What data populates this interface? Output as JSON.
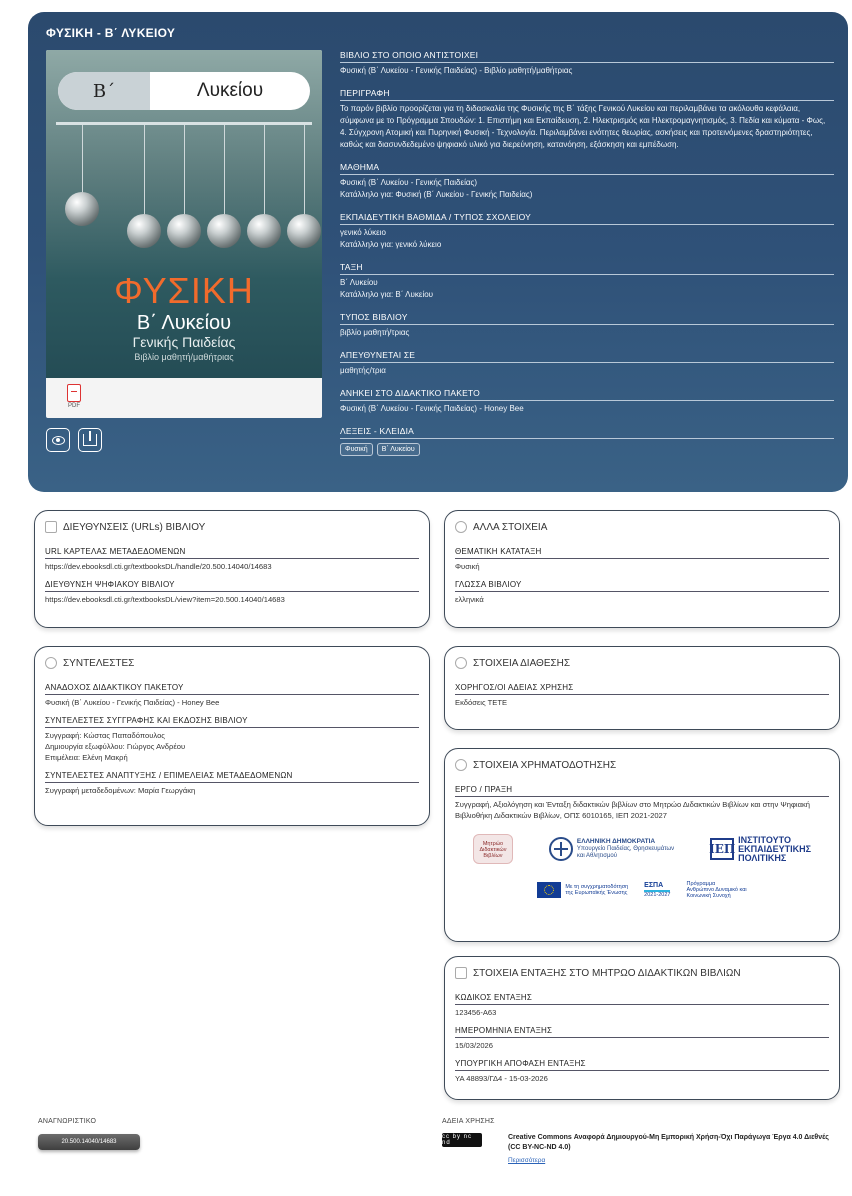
{
  "hero": {
    "title": "ΦΥΣΙΚΗ - Β΄ ΛΥΚΕΙΟΥ",
    "cover": {
      "pill_left": "Β΄",
      "pill_right": "Λυκείου",
      "big_title": "ΦΥΣΙΚΗ",
      "sub1": "Β΄ Λυκείου",
      "sub2": "Γενικής Παιδείας",
      "sub3": "Βιβλίο μαθητή/μαθήτριας",
      "pdf_label": "PDF"
    },
    "icons": {
      "view": "eye-icon",
      "download": "download-icon",
      "pdf": "pdf-icon"
    },
    "meta": [
      {
        "label": "ΒΙΒΛΙΟ ΣΤΟ ΟΠΟΙΟ ΑΝΤΙΣΤΟΙΧΕΙ",
        "values": [
          "Φυσική (Β΄ Λυκείου - Γενικής Παιδείας) - Βιβλίο μαθητή/μαθήτριας"
        ]
      },
      {
        "label": "ΠΕΡΙΓΡΑΦΗ",
        "values": [
          "Το παρόν βιβλίο προορίζεται για τη διδασκαλία της Φυσικής της Β΄ τάξης Γενικού Λυκείου και περιλαμβάνει τα ακόλουθα κεφάλαια, σύμφωνα με το Πρόγραμμα Σπουδών: 1. Επιστήμη και Εκπαίδευση, 2. Ηλεκτρισμός και Ηλεκτρομαγνητισμός, 3. Πεδία και κύματα - Φως, 4. Σύγχρονη Ατομική και Πυρηνική Φυσική - Τεχνολογία. Περιλαμβάνει ενότητες θεωρίας, ασκήσεις και προτεινόμενες δραστηριότητες, καθώς και διασυνδεδεμένο ψηφιακό υλικό για διερεύνηση, κατανόηση, εξάσκηση και εμπέδωση."
        ]
      },
      {
        "label": "ΜΑΘΗΜΑ",
        "values": [
          "Φυσική (Β΄ Λυκείου - Γενικής Παιδείας)",
          "Κατάλληλο για: Φυσική (Β΄ Λυκείου - Γενικής Παιδείας)"
        ]
      },
      {
        "label": "ΕΚΠΑΙΔΕΥΤΙΚΗ ΒΑΘΜΙΔΑ / ΤΥΠΟΣ ΣΧΟΛΕΙΟΥ",
        "values": [
          "γενικό λύκειο",
          "Κατάλληλο για: γενικό λύκειο"
        ]
      },
      {
        "label": "ΤΑΞΗ",
        "values": [
          "Β΄ Λυκείου",
          "Κατάλληλο για: Β΄ Λυκείου"
        ]
      },
      {
        "label": "ΤΥΠΟΣ ΒΙΒΛΙΟΥ",
        "values": [
          "βιβλίο μαθητή/τριας"
        ]
      },
      {
        "label": "ΑΠΕΥΘΥΝΕΤΑΙ ΣΕ",
        "values": [
          "μαθητής/τρια"
        ]
      },
      {
        "label": "ΑΝΗΚΕΙ ΣΤΟ ΔΙΔΑΚΤΙΚΟ ΠΑΚΕΤΟ",
        "values": [
          "Φυσική (Β΄ Λυκείου - Γενικής Παιδείας) - Honey Bee"
        ]
      }
    ],
    "keywords_label": "ΛΕΞΕΙΣ - ΚΛΕΙΔΙΑ",
    "keywords": [
      "Φυσική",
      "Β΄ Λυκείου"
    ]
  },
  "cards": {
    "urls": {
      "title": "ΔΙΕΥΘΥΝΣΕΙΣ (URLs) ΒΙΒΛΙΟΥ",
      "fields": [
        {
          "label": "URL ΚΑΡΤΕΛΑΣ ΜΕΤΑΔΕΔΟΜΕΝΩΝ",
          "values": [
            "https://dev.ebooksdl.cti.gr/textbooksDL/handle/20.500.14040/14683"
          ]
        },
        {
          "label": "ΔΙΕΥΘΥΝΣΗ ΨΗΦΙΑΚΟΥ ΒΙΒΛΙΟΥ",
          "values": [
            "https://dev.ebooksdl.cti.gr/textbooksDL/view?item=20.500.14040/14683"
          ]
        }
      ]
    },
    "other": {
      "title": "ΑΛΛΑ ΣΤΟΙΧΕΙΑ",
      "fields": [
        {
          "label": "ΘΕΜΑΤΙΚΗ ΚΑΤΑΤΑΞΗ",
          "values": [
            "Φυσική"
          ]
        },
        {
          "label": "ΓΛΩΣΣΑ ΒΙΒΛΙΟΥ",
          "values": [
            "ελληνικά"
          ]
        }
      ]
    },
    "contributors": {
      "title": "ΣΥΝΤΕΛΕΣΤΕΣ",
      "fields": [
        {
          "label": "ΑΝΑΔΟΧΟΣ ΔΙΔΑΚΤΙΚΟΥ ΠΑΚΕΤΟΥ",
          "values": [
            "Φυσική (Β΄ Λυκείου - Γενικής Παιδείας) - Honey Bee"
          ]
        },
        {
          "label": "ΣΥΝΤΕΛΕΣΤΕΣ ΣΥΓΓΡΑΦΗΣ ΚΑΙ ΕΚΔΟΣΗΣ ΒΙΒΛΙΟΥ",
          "values": [
            "Συγγραφή: Κώστας Παπαδόπουλος",
            "Δημιουργία εξωφύλλου: Γιώργος Ανδρέου",
            "Επιμέλεια: Ελένη Μακρή"
          ]
        },
        {
          "label": "ΣΥΝΤΕΛΕΣΤΕΣ ΑΝΑΠΤΥΞΗΣ / ΕΠΙΜΕΛΕΙΑΣ ΜΕΤΑΔΕΔΟΜΕΝΩΝ",
          "values": [
            "Συγγραφή μεταδεδομένων: Μαρία Γεωργάκη"
          ]
        }
      ]
    },
    "availability": {
      "title": "ΣΤΟΙΧΕΙΑ ΔΙΑΘΕΣΗΣ",
      "fields": [
        {
          "label": "ΧΟΡΗΓΟΣ/ΟΙ ΑΔΕΙΑΣ ΧΡΗΣΗΣ",
          "values": [
            "Εκδόσεις ΤΕΤΕ"
          ]
        }
      ]
    },
    "funding": {
      "title": "ΣΤΟΙΧΕΙΑ ΧΡΗΜΑΤΟΔΟΤΗΣΗΣ",
      "fields": [
        {
          "label": "ΕΡΓΟ / ΠΡΑΞΗ",
          "values": [
            "Συγγραφή, Αξιολόγηση και Ένταξη διδακτικών βιβλίων στο Μητρώο Διδακτικών Βιβλίων και στην Ψηφιακή Βιβλιοθήκη Διδακτικών Βιβλίων, ΟΠΣ 6010165, ΙΕΠ 2021-2027"
          ]
        }
      ],
      "logos": {
        "mitroo": [
          "Μητρώο",
          "Διδακτικών",
          "Βιβλίων"
        ],
        "greek_title": "ΕΛΛΗΝΙΚΗ ΔΗΜΟΚΡΑΤΙΑ",
        "greek_sub": [
          "Υπουργείο Παιδείας, Θρησκευμάτων",
          "και Αθλητισμού"
        ],
        "iep_mark": "ΙΕΠ",
        "iep_text": [
          "ΙΝΣΤΙΤΟΥΤΟ",
          "ΕΚΠΑΙΔΕΥΤΙΚΗΣ",
          "ΠΟΛΙΤΙΚΗΣ"
        ],
        "eu_text": [
          "Με τη συγχρηματοδότηση",
          "της Ευρωπαϊκής Ένωσης"
        ],
        "espa": "ΕΣΠΑ",
        "espa_sub": "2021-2027",
        "prog": [
          "Πρόγραμμα",
          "Ανθρώπινο Δυναμικό και",
          "Κοινωνική Συνοχή"
        ]
      }
    },
    "registry": {
      "title": "ΣΤΟΙΧΕΙΑ ΕΝΤΑΞΗΣ ΣΤΟ ΜΗΤΡΩΟ ΔΙΔΑΚΤΙΚΩΝ ΒΙΒΛΙΩΝ",
      "fields": [
        {
          "label": "ΚΩΔΙΚΟΣ ΕΝΤΑΞΗΣ",
          "values": [
            "123456-A63"
          ]
        },
        {
          "label": "ΗΜΕΡΟΜΗΝΙΑ ΕΝΤΑΞΗΣ",
          "values": [
            "15/03/2026"
          ]
        },
        {
          "label": "ΥΠΟΥΡΓΙΚΗ ΑΠΟΦΑΣΗ ΕΝΤΑΞΗΣ",
          "values": [
            "ΥΑ 48893/ΓΔ4 - 15-03-2026"
          ]
        }
      ]
    }
  },
  "footer": {
    "id_label": "ΑΝΑΓΝΩΡΙΣΤΙΚΟ",
    "id_value": "20.500.14040/14683",
    "license_label": "ΑΔΕΙΑ ΧΡΗΣΗΣ",
    "cc_badge": "cc by nc nd",
    "license_text": "Creative Commons Αναφορά Δημιουργού-Μη Εμπορική Χρήση-Όχι Παράγωγα Έργα 4.0 Διεθνές (CC BY-NC-ND 4.0)",
    "more_link": "Περισσότερα"
  }
}
